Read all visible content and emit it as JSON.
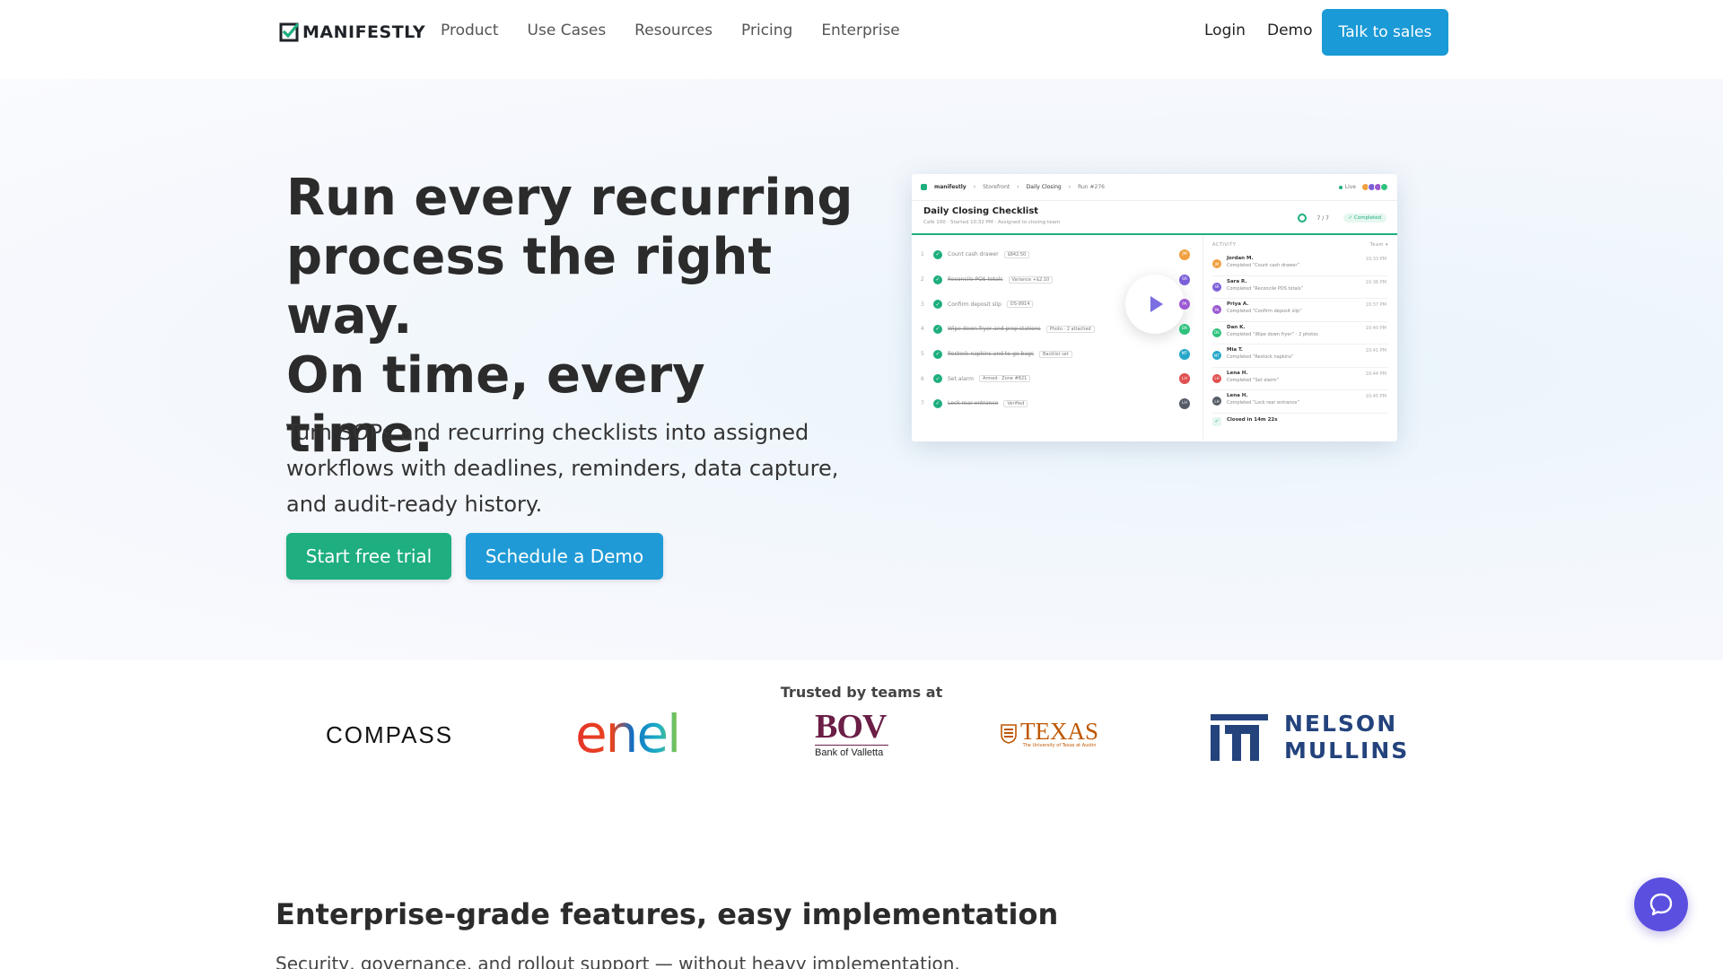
{
  "nav": {
    "logo_text": "MANIFESTLY",
    "links": [
      "Product",
      "Use Cases",
      "Resources",
      "Pricing",
      "Enterprise"
    ],
    "login": "Login",
    "demo": "Demo",
    "cta": "Talk to sales"
  },
  "hero": {
    "title_line1": "Run every recurring",
    "title_line2": "process the right",
    "title_line3": "way.",
    "title_line4": "On time, every time.",
    "subtitle": "Turn SOPs and recurring checklists into assigned workflows with deadlines, reminders, data capture, and audit-ready history.",
    "primary_cta": "Start free trial",
    "secondary_cta": "Schedule a Demo"
  },
  "preview": {
    "breadcrumb": [
      "manifestly",
      "Storefront",
      "Daily Closing",
      "Run #276"
    ],
    "live": "Live",
    "checklist_title": "Daily Closing Checklist",
    "checklist_meta": "Café 100 · Started 10:32 PM · Assigned to closing team",
    "progress": "7 / 7",
    "status": "Completed",
    "tasks": [
      {
        "n": "1",
        "label": "Count cash drawer",
        "tag": "$842.50",
        "av": "JM",
        "color": "#f0a040",
        "strike": false
      },
      {
        "n": "2",
        "label": "Reconcile POS totals",
        "tag": "Variance +$2.10",
        "av": "SR",
        "color": "#7a5fd8",
        "strike": true
      },
      {
        "n": "3",
        "label": "Confirm deposit slip",
        "tag": "DS-9914",
        "av": "PA",
        "color": "#9b59d0",
        "strike": false
      },
      {
        "n": "4",
        "label": "Wipe down fryer and prep stations",
        "tag": "Photo · 2 attached",
        "av": "DK",
        "color": "#2ec27e",
        "strike": true
      },
      {
        "n": "5",
        "label": "Restock napkins and to-go bags",
        "tag": "Backlist set",
        "av": "MT",
        "color": "#26a7c9",
        "strike": true
      },
      {
        "n": "6",
        "label": "Set alarm",
        "tag": "Armed · Zone #821",
        "av": "LH",
        "color": "#e05050",
        "strike": false
      },
      {
        "n": "7",
        "label": "Lock rear entrance",
        "tag": "Verified",
        "av": "LH",
        "color": "#555b66",
        "strike": true
      }
    ],
    "activity_header": "ACTIVITY",
    "activity_filter": "Team ▾",
    "activity": [
      {
        "who": "Jordan M.",
        "what": "Completed “Count cash drawer”",
        "tm": "10:33 PM",
        "av": "JM",
        "color": "#f0a040"
      },
      {
        "who": "Sara R.",
        "what": "Completed “Reconcile POS totals”",
        "tm": "10:36 PM",
        "av": "SR",
        "color": "#7a5fd8"
      },
      {
        "who": "Priya A.",
        "what": "Completed “Confirm deposit slip”",
        "tm": "10:37 PM",
        "av": "PA",
        "color": "#9b59d0"
      },
      {
        "who": "Dan K.",
        "what": "Completed “Wipe down fryer” · 2 photos",
        "tm": "10:40 PM",
        "av": "DK",
        "color": "#2ec27e"
      },
      {
        "who": "Mia T.",
        "what": "Completed “Restock napkins”",
        "tm": "10:41 PM",
        "av": "MT",
        "color": "#26a7c9"
      },
      {
        "who": "Lena H.",
        "what": "Completed “Set alarm”",
        "tm": "10:44 PM",
        "av": "LH",
        "color": "#e05050"
      },
      {
        "who": "Lena H.",
        "what": "Completed “Lock rear entrance”",
        "tm": "10:45 PM",
        "av": "LH",
        "color": "#555b66"
      }
    ],
    "closed_text": "Closed in 14m 22s"
  },
  "trusted": {
    "label": "Trusted by teams at",
    "logos": {
      "compass": "COMPASS",
      "enel": "enel",
      "bov": "BOV",
      "bov_sub": "Bank of Valletta",
      "texas": "TEXAS",
      "texas_sub": "The University of Texas at Austin",
      "nelson_1": "NELSON",
      "nelson_2": "MULLINS"
    }
  },
  "features": {
    "title": "Enterprise-grade features, easy implementation",
    "subtitle": "Security, governance, and rollout support — without heavy implementation."
  },
  "colors": {
    "brand_green": "#1eae7f",
    "brand_blue": "#1a9ad6",
    "chat_purple": "#5b4fe0"
  }
}
